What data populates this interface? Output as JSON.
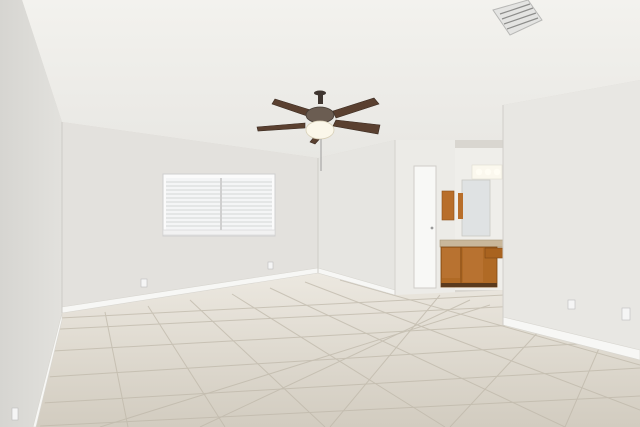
{
  "scene": {
    "subject": "empty-bedroom-with-ceiling-fan",
    "colors": {
      "ceiling": "#f1f0ec",
      "wall_back": "#e4e2de",
      "wall_left": "#dddcd8",
      "wall_right": "#e9e8e4",
      "floor_tile": "#d4cec2",
      "grout": "#bdb6a8",
      "baseboard": "#f7f7f5",
      "fan_blade": "#5a4030",
      "cabinet": "#b06a25",
      "window_light": "#f6f7f8"
    }
  }
}
